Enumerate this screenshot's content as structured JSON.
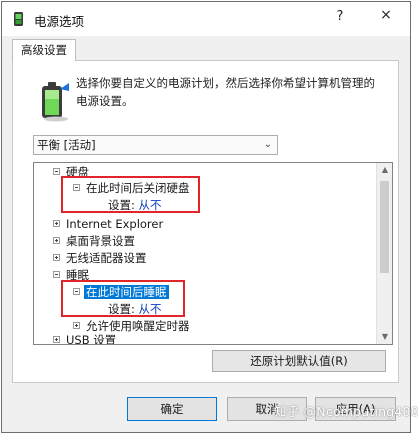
{
  "window": {
    "title": "电源选项",
    "help_glyph": "?",
    "close_glyph": "×"
  },
  "tab": {
    "label": "高级设置"
  },
  "description": "选择你要自定义的电源计划，然后选择你希望计算机管理的电源设置。",
  "plan_select": {
    "value": "平衡 [活动]",
    "arrow": "⌄"
  },
  "tree": {
    "hard_disk": "硬盘",
    "turn_off_disk_after": "在此时间后关闭硬盘",
    "disk_setting_label": "设置:",
    "disk_setting_value": "从不",
    "internet_explorer": "Internet Explorer",
    "desktop_background": "桌面背景设置",
    "wireless_adapter": "无线适配器设置",
    "sleep": "睡眠",
    "sleep_after": "在此时间后睡眠",
    "sleep_setting_label": "设置:",
    "sleep_setting_value": "从不",
    "allow_wake_timers": "允许使用唤醒定时器",
    "usb_settings": "USB 设置"
  },
  "scrollbar": {
    "up": "▲",
    "down": "▼"
  },
  "buttons": {
    "restore_defaults": "还原计划默认值(R)",
    "ok": "确定",
    "cancel": "取消",
    "apply": "应用(A)"
  },
  "watermark": "知乎 @Ncomputing400",
  "colors": {
    "selection": "#0078d7",
    "highlight_box": "#e0252b",
    "setting_value": "#0b3fbf"
  }
}
